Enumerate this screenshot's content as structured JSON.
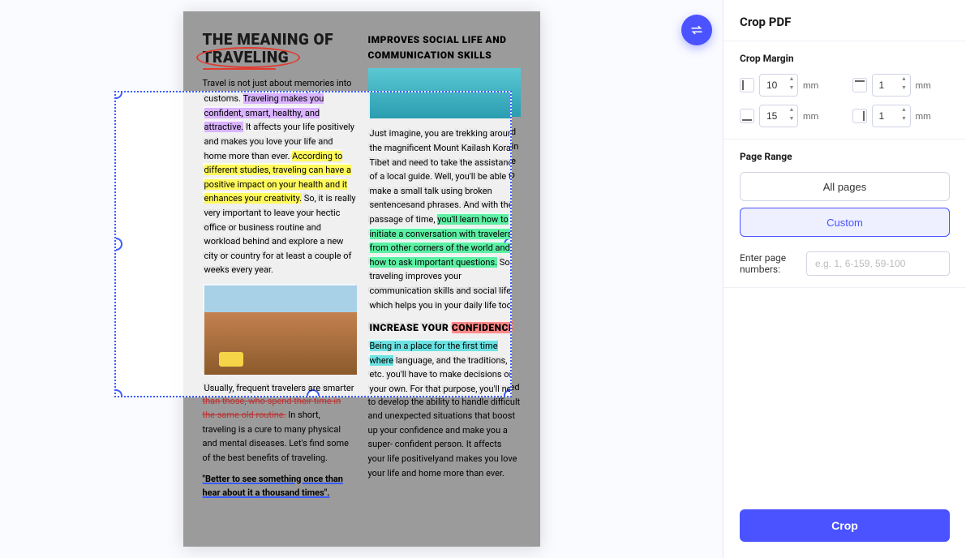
{
  "sidebar": {
    "title": "Crop PDF",
    "crop_margin_label": "Crop Margin",
    "unit": "mm",
    "margins": {
      "left": "10",
      "top": "1",
      "bottom": "15",
      "right": "1"
    },
    "page_range_label": "Page Range",
    "all_pages_label": "All pages",
    "custom_label": "Custom",
    "enter_pages_label": "Enter page numbers:",
    "enter_pages_placeholder": "e.g. 1, 6-159, 59-100",
    "crop_button": "Crop"
  },
  "document": {
    "title_line1": "THE MEANING OF",
    "title_line2": "TRAVELING",
    "col1": {
      "p1_a": "Travel is not just about memories into customs.",
      "p1_hl_purple": "Traveling makes you confident, smart, healthy, and attractive.",
      "p1_b": " It affects your life positively and makes you love your life and home more than ever. ",
      "p1_hl_yellow": "According to different studies, traveling can have a positive impact on your health and it enhances your creativity.",
      "p1_c": " So, it is really very important to leave your hectic office or business routine and workload behind and explore a new city or country for at least a couple of weeks every year.",
      "p2_a": "Usually, frequent travelers are smarter ",
      "p2_strike": "than those, who spend their time in the same old routine.",
      "p2_b": " In short, traveling is a cure to many physical and mental diseases. Let's find some of the best benefits of traveling.",
      "quote": "\"Better to see something once than hear about it a thousand times\"."
    },
    "col2": {
      "h1": "IMPROVES SOCIAL LIFE AND COMMUNICATION SKILLS",
      "p1_a": "Just imagine, you are trekking around the magnificent Mount Kailash Kora in Tibet and need to take the assistance of a local guide. Well, you'll be able to make a small talk using broken sentencesand phrases. And with the passage of time, ",
      "p1_hl_green": "you'll learn how to initiate a conversation with travelers from other corners of the world and how to ask important questions.",
      "p1_b": " So, traveling improves your communication skills and social life which helps you in your daily life too.",
      "h2_a": "INCREASE YOUR ",
      "h2_hl": "CONFIDENCE",
      "p2_hl_cyan": "Being in a place for the first time where",
      "p2_a": " language, and the traditions, etc. you'll have to make decisions on your own. For that purpose, you'll need to develop the ability to handle difficult and unexpected situations that boost up your confidence and make you a super- confident person. It affects your life positivelyand makes you love your life and home more than ever."
    }
  }
}
